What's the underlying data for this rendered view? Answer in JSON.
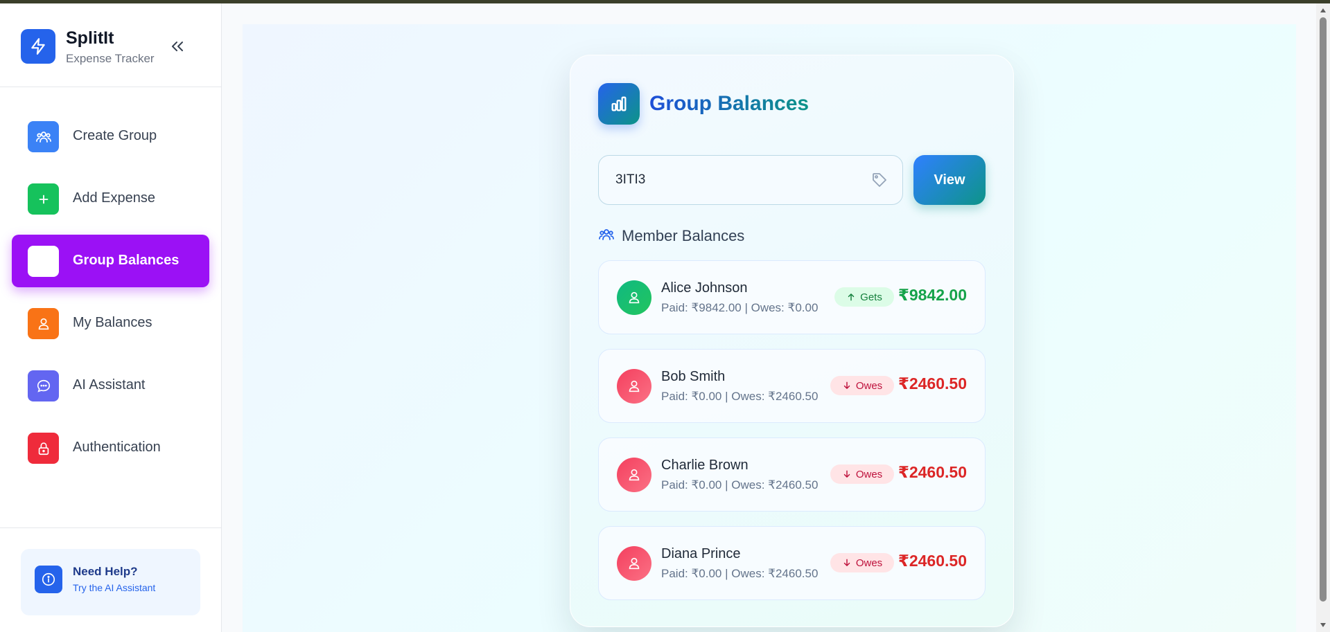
{
  "brand": {
    "title": "SplitIt",
    "subtitle": "Expense Tracker",
    "logo_icon": "lightning-icon",
    "collapse_icon": "double-chevron-left-icon"
  },
  "sidebar": {
    "items": [
      {
        "label": "Create Group",
        "icon": "users-icon",
        "color": "#3b82f6",
        "active": false
      },
      {
        "label": "Add Expense",
        "icon": "plus-icon",
        "color": "#16c25c",
        "active": false
      },
      {
        "label": "Group Balances",
        "icon": "bar-chart-icon",
        "color": "#ffffff",
        "active": true
      },
      {
        "label": "My Balances",
        "icon": "user-icon",
        "color": "#f97316",
        "active": false
      },
      {
        "label": "AI Assistant",
        "icon": "chat-icon",
        "color": "#6366f1",
        "active": false
      },
      {
        "label": "Authentication",
        "icon": "lock-icon",
        "color": "#ef2b3b",
        "active": false
      }
    ],
    "active_color": "#9b11f5"
  },
  "help": {
    "title": "Need Help?",
    "subtitle": "Try the AI Assistant",
    "icon": "info-icon"
  },
  "card": {
    "title": "Group Balances",
    "icon": "bar-chart-icon"
  },
  "group_input": {
    "value": "3ITI3",
    "icon": "tag-icon"
  },
  "view_button": {
    "label": "View"
  },
  "members_section": {
    "title": "Member Balances",
    "icon": "users-icon",
    "members": [
      {
        "name": "Alice Johnson",
        "detail": "Paid: ₹9842.00 | Owes: ₹0.00",
        "status": "Gets",
        "amount": "₹9842.00",
        "positive": true
      },
      {
        "name": "Bob Smith",
        "detail": "Paid: ₹0.00 | Owes: ₹2460.50",
        "status": "Owes",
        "amount": "₹2460.50",
        "positive": false
      },
      {
        "name": "Charlie Brown",
        "detail": "Paid: ₹0.00 | Owes: ₹2460.50",
        "status": "Owes",
        "amount": "₹2460.50",
        "positive": false
      },
      {
        "name": "Diana Prince",
        "detail": "Paid: ₹0.00 | Owes: ₹2460.50",
        "status": "Owes",
        "amount": "₹2460.50",
        "positive": false
      }
    ]
  },
  "colors": {
    "positive": "#16a34a",
    "negative": "#dc2626",
    "brand": "#2563eb",
    "accent_teal": "#0d9488"
  }
}
